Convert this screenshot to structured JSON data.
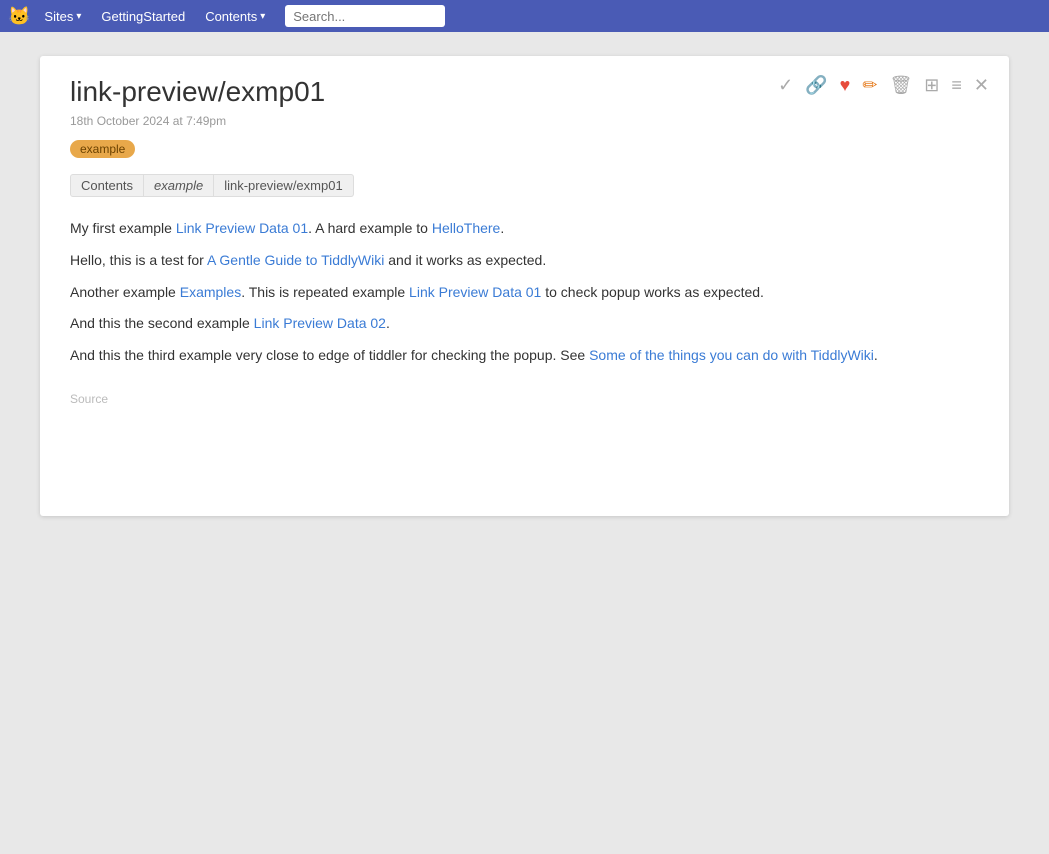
{
  "navbar": {
    "logo": "🐱",
    "sites_label": "Sites",
    "getting_started_label": "GettingStarted",
    "contents_label": "Contents",
    "search_placeholder": "Search..."
  },
  "toolbar": {
    "icons": [
      "✓",
      "🔗",
      "♥",
      "✏",
      "🗑",
      "⊞",
      "≡",
      "✕"
    ]
  },
  "tiddler": {
    "title": "link-preview/exmp01",
    "date": "18th October 2024 at 7:49pm",
    "tag": "example",
    "breadcrumb": [
      {
        "label": "Contents",
        "style": "normal"
      },
      {
        "label": "example",
        "style": "italic"
      },
      {
        "label": "link-preview/exmp01",
        "style": "normal"
      }
    ],
    "paragraphs": [
      {
        "parts": [
          {
            "text": "My first example ",
            "type": "plain"
          },
          {
            "text": "Link Preview Data 01",
            "type": "link"
          },
          {
            "text": ". A hard example to ",
            "type": "plain"
          },
          {
            "text": "HelloThere",
            "type": "link"
          },
          {
            "text": ".",
            "type": "plain"
          }
        ]
      },
      {
        "parts": [
          {
            "text": "Hello, this is a test for ",
            "type": "plain"
          },
          {
            "text": "A Gentle Guide to TiddlyWiki",
            "type": "link"
          },
          {
            "text": " and it works as expected.",
            "type": "plain"
          }
        ]
      },
      {
        "parts": [
          {
            "text": "Another example ",
            "type": "plain"
          },
          {
            "text": "Examples",
            "type": "link"
          },
          {
            "text": ". This is repeated example ",
            "type": "plain"
          },
          {
            "text": "Link Preview Data 01",
            "type": "link"
          },
          {
            "text": " to check popup works as expected.",
            "type": "plain"
          }
        ]
      },
      {
        "parts": [
          {
            "text": "And this the second example ",
            "type": "plain"
          },
          {
            "text": "Link Preview Data 02",
            "type": "link"
          },
          {
            "text": ".",
            "type": "plain"
          }
        ]
      },
      {
        "parts": [
          {
            "text": "And this the third example very close to edge of tiddler for checking the popup. See ",
            "type": "plain"
          },
          {
            "text": "Some of the things you can do with TiddlyWiki",
            "type": "link"
          },
          {
            "text": ".",
            "type": "plain"
          }
        ]
      }
    ],
    "source_label": "Source"
  }
}
